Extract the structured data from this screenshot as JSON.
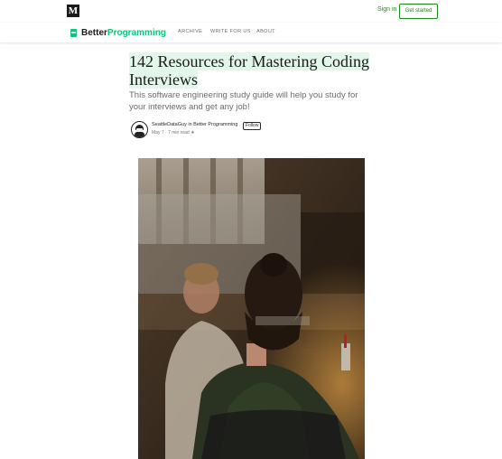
{
  "topbar": {
    "logo": "M",
    "sign_in": "Sign in",
    "get_started": "Get started"
  },
  "publication": {
    "name_part1": "Better",
    "name_part2": "Programming",
    "nav": [
      "ARCHIVE",
      "WRITE FOR US",
      "ABOUT"
    ]
  },
  "article": {
    "title": "142 Resources for Mastering Coding Interviews",
    "subtitle": "This software engineering study guide will help you study for your interviews and get any job!",
    "author": "SeattleDataGuy",
    "in_text": "in",
    "publication": "Better Programming",
    "follow_label": "Follow",
    "date": "May 7",
    "read_time": "7 min read",
    "star": "★"
  },
  "colors": {
    "brand_green": "#1a8917",
    "pub_accent": "#13c27b",
    "highlight": "#e3f6ea"
  }
}
